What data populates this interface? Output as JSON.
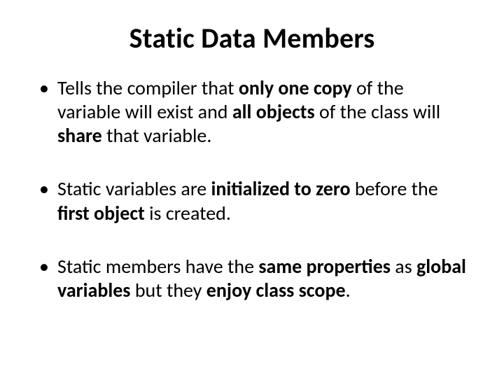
{
  "slide": {
    "title": "Static Data Members",
    "bullets": [
      {
        "segments": [
          {
            "t": "Tells the compiler that ",
            "b": false
          },
          {
            "t": "only one copy",
            "b": true
          },
          {
            "t": " of the variable will exist and ",
            "b": false
          },
          {
            "t": "all objects",
            "b": true
          },
          {
            "t": " of the class will ",
            "b": false
          },
          {
            "t": "share",
            "b": true
          },
          {
            "t": " that variable.",
            "b": false
          }
        ]
      },
      {
        "segments": [
          {
            "t": "Static variables are ",
            "b": false
          },
          {
            "t": "initialized to zero",
            "b": true
          },
          {
            "t": " before the ",
            "b": false
          },
          {
            "t": "first object",
            "b": true
          },
          {
            "t": " is created.",
            "b": false
          }
        ]
      },
      {
        "segments": [
          {
            "t": "Static members have the ",
            "b": false
          },
          {
            "t": "same properties",
            "b": true
          },
          {
            "t": " as ",
            "b": false
          },
          {
            "t": "global variables",
            "b": true
          },
          {
            "t": " but they ",
            "b": false
          },
          {
            "t": "enjoy class scope",
            "b": true
          },
          {
            "t": ".",
            "b": false
          }
        ]
      }
    ]
  }
}
